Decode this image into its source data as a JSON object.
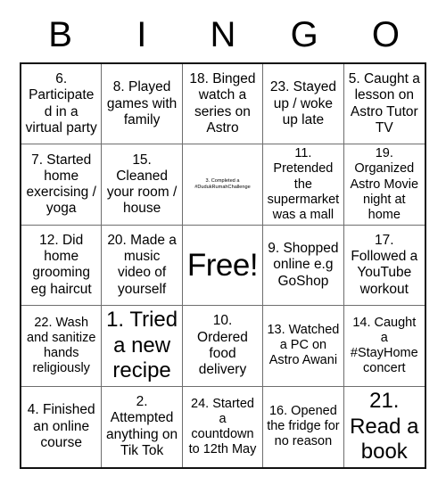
{
  "header": {
    "letters": [
      "B",
      "I",
      "N",
      "G",
      "O"
    ]
  },
  "grid": {
    "rows": 5,
    "columns": 5,
    "cells": [
      {
        "text": "6. Participated in a virtual party",
        "size": "normal"
      },
      {
        "text": "8. Played games with family",
        "size": "normal"
      },
      {
        "text": "18. Binged watch a series on Astro",
        "size": "normal"
      },
      {
        "text": "23. Stayed up / woke up late",
        "size": "normal"
      },
      {
        "text": "5. Caught a lesson on Astro Tutor TV",
        "size": "normal"
      },
      {
        "text": "7. Started home exercising / yoga",
        "size": "normal"
      },
      {
        "text": "15. Cleaned your room / house",
        "size": "normal"
      },
      {
        "text": "3. Completed a #DudukRumahChallenge",
        "size": "tiny"
      },
      {
        "text": "11. Pretended the supermarket was a mall",
        "size": "small"
      },
      {
        "text": "19. Organized Astro Movie night at home",
        "size": "small"
      },
      {
        "text": "12. Did home grooming eg haircut",
        "size": "normal"
      },
      {
        "text": "20. Made a music video of yourself",
        "size": "normal"
      },
      {
        "text": "Free!",
        "size": "free"
      },
      {
        "text": "9. Shopped online e.g GoShop",
        "size": "normal"
      },
      {
        "text": "17. Followed a YouTube workout",
        "size": "normal"
      },
      {
        "text": "22. Wash and sanitize hands religiously",
        "size": "small"
      },
      {
        "text": "1. Tried a new recipe",
        "size": "big"
      },
      {
        "text": "10. Ordered food delivery",
        "size": "normal"
      },
      {
        "text": "13. Watched a PC on Astro Awani",
        "size": "small"
      },
      {
        "text": "14. Caught a #StayHome concert",
        "size": "small"
      },
      {
        "text": "4. Finished an online course",
        "size": "normal"
      },
      {
        "text": "2. Attempted anything on Tik Tok",
        "size": "normal"
      },
      {
        "text": "24. Started a countdown to 12th May",
        "size": "small"
      },
      {
        "text": "16. Opened the fridge for no reason",
        "size": "small"
      },
      {
        "text": "21. Read a book",
        "size": "big"
      }
    ]
  },
  "colors": {
    "background": "#ffffff",
    "text": "#000000",
    "outer_border": "#111111",
    "inner_border": "#6e6e6e"
  }
}
